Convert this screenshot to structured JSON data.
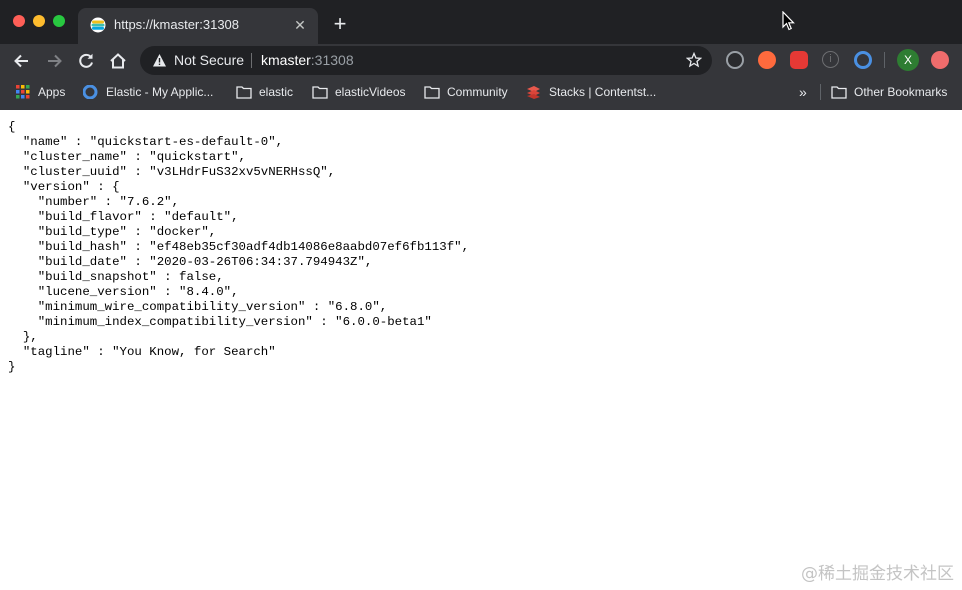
{
  "browser": {
    "tab_title": "https://kmaster:31308",
    "security_label": "Not Secure",
    "url_host": "kmaster",
    "url_port": ":31308"
  },
  "bookmarks": {
    "items": [
      {
        "label": "Apps",
        "icon": "apps-grid-icon"
      },
      {
        "label": "Elastic - My Applic...",
        "icon": "elastic-icon"
      },
      {
        "label": "elastic",
        "icon": "folder-icon"
      },
      {
        "label": "elasticVideos",
        "icon": "folder-icon"
      },
      {
        "label": "Community",
        "icon": "folder-icon"
      },
      {
        "label": "Stacks | Contentst...",
        "icon": "contentstack-icon"
      }
    ],
    "overflow": "»",
    "other_label": "Other Bookmarks"
  },
  "extensions": [
    {
      "name": "extension-gray-icon",
      "color": "#9aa0a6"
    },
    {
      "name": "extension-orange-icon",
      "color": "#ff6a3d"
    },
    {
      "name": "extension-red-hand-icon",
      "color": "#e53935"
    },
    {
      "name": "extension-info-icon",
      "color": "#6d6e71"
    },
    {
      "name": "extension-blue-icon",
      "color": "#4a90e2"
    },
    {
      "name": "profile-avatar",
      "color": "#2e7d32",
      "label": "X"
    },
    {
      "name": "extension-pink-icon",
      "color": "#ef6c6c"
    }
  ],
  "content": {
    "json_text": "{\n  \"name\" : \"quickstart-es-default-0\",\n  \"cluster_name\" : \"quickstart\",\n  \"cluster_uuid\" : \"v3LHdrFuS32xv5vNERHssQ\",\n  \"version\" : {\n    \"number\" : \"7.6.2\",\n    \"build_flavor\" : \"default\",\n    \"build_type\" : \"docker\",\n    \"build_hash\" : \"ef48eb35cf30adf4db14086e8aabd07ef6fb113f\",\n    \"build_date\" : \"2020-03-26T06:34:37.794943Z\",\n    \"build_snapshot\" : false,\n    \"lucene_version\" : \"8.4.0\",\n    \"minimum_wire_compatibility_version\" : \"6.8.0\",\n    \"minimum_index_compatibility_version\" : \"6.0.0-beta1\"\n  },\n  \"tagline\" : \"You Know, for Search\"\n}"
  },
  "watermark": "@稀土掘金技术社区"
}
